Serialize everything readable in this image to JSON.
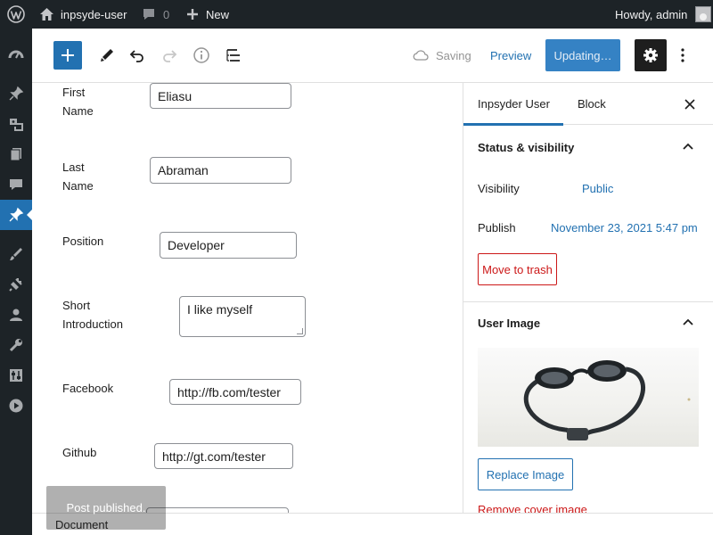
{
  "admin_bar": {
    "site_name": "inpsyde-user",
    "comments_count": "0",
    "new_label": "New",
    "howdy": "Howdy, admin"
  },
  "admin_menu": {
    "items": [
      "dashboard-icon",
      "posts-icon",
      "media-icon",
      "pages-icon",
      "comments-icon",
      "inpsyder-users-icon",
      "appearance-icon",
      "plugins-icon",
      "users-icon",
      "tools-icon",
      "settings-icon",
      "video-icon"
    ],
    "current": "inpsyder-users-icon"
  },
  "editor_header": {
    "saving_label": "Saving",
    "preview_label": "Preview",
    "update_label": "Updating…"
  },
  "form": {
    "first_name": {
      "label": "First Name",
      "value": "Eliasu"
    },
    "last_name": {
      "label": "Last Name",
      "value": "Abraman"
    },
    "position": {
      "label": "Position",
      "value": "Developer"
    },
    "short_intro": {
      "label": "Short Introduction",
      "value": "I like myself"
    },
    "facebook": {
      "label": "Facebook",
      "value": "http://fb.com/tester"
    },
    "github": {
      "label": "Github",
      "value": "http://gt.com/tester"
    }
  },
  "sidebar": {
    "tabs": [
      "Inpsyder User",
      "Block"
    ],
    "active_tab": "Inpsyder User",
    "status_panel": {
      "title": "Status & visibility",
      "visibility_label": "Visibility",
      "visibility_value": "Public",
      "publish_label": "Publish",
      "publish_value": "November 23, 2021 5:47 pm",
      "trash_label": "Move to trash"
    },
    "image_panel": {
      "title": "User Image",
      "replace_label": "Replace Image",
      "remove_label": "Remove cover image"
    }
  },
  "footer": {
    "breadcrumb": "Document"
  },
  "snackbar": {
    "message": "Post published."
  },
  "colors": {
    "accent": "#2271b1",
    "admin_bar": "#1d2327",
    "danger": "#cc1818"
  }
}
